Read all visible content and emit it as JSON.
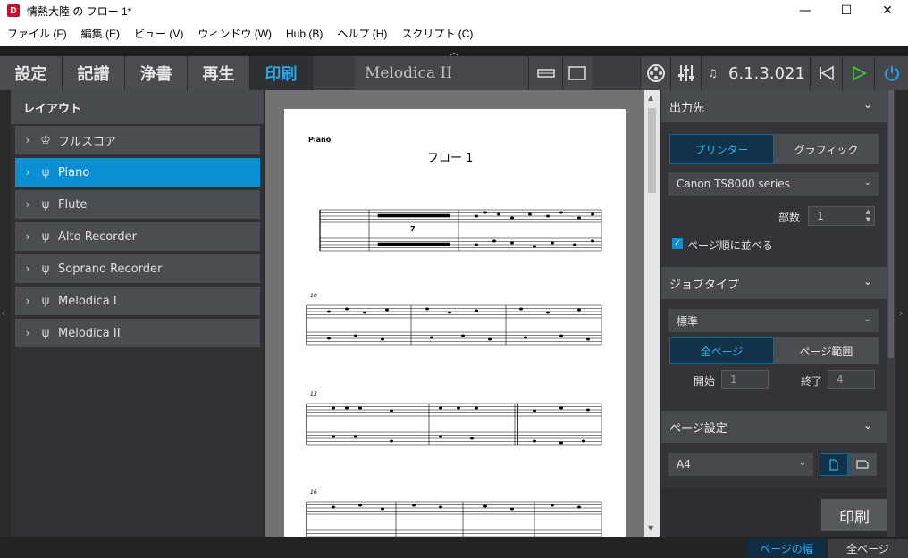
{
  "window": {
    "title": "情熱大陸 の フロー 1*"
  },
  "menu": [
    "ファイル (F)",
    "編集 (E)",
    "ビュー (V)",
    "ウィンドウ (W)",
    "Hub (B)",
    "ヘルプ (H)",
    "スクリプト (C)"
  ],
  "modes": [
    "設定",
    "記譜",
    "浄書",
    "再生",
    "印刷"
  ],
  "active_mode": "印刷",
  "project_title": "Melodica II",
  "version": "6.1.3.021",
  "layouts": {
    "header": "レイアウト",
    "items": [
      {
        "label": "フルスコア",
        "icon": "full-score-icon"
      },
      {
        "label": "Piano",
        "icon": "part-icon",
        "selected": true
      },
      {
        "label": "Flute",
        "icon": "part-icon"
      },
      {
        "label": "Alto Recorder",
        "icon": "part-icon"
      },
      {
        "label": "Soprano Recorder",
        "icon": "part-icon"
      },
      {
        "label": "Melodica I",
        "icon": "part-icon"
      },
      {
        "label": "Melodica II",
        "icon": "part-icon"
      }
    ]
  },
  "score": {
    "part_name": "Piano",
    "title": "フロー 1",
    "system_numbers": [
      "10",
      "13",
      "16"
    ],
    "multirest": "7"
  },
  "output": {
    "header": "出力先",
    "printer_label": "プリンター",
    "graphic_label": "グラフィック",
    "printer_name": "Canon TS8000 series",
    "copies_label": "部数",
    "copies_value": "1",
    "collate_label": "ページ順に並べる"
  },
  "job": {
    "header": "ジョブタイプ",
    "type_value": "標準",
    "all_pages": "全ページ",
    "page_range": "ページ範囲",
    "start_label": "開始",
    "start_value": "1",
    "end_label": "終了",
    "end_value": "4"
  },
  "page_setup": {
    "header": "ページ設定",
    "size_value": "A4"
  },
  "print_button": "印刷",
  "status": {
    "page_width": "ページの幅",
    "all_pages": "全ページ"
  }
}
